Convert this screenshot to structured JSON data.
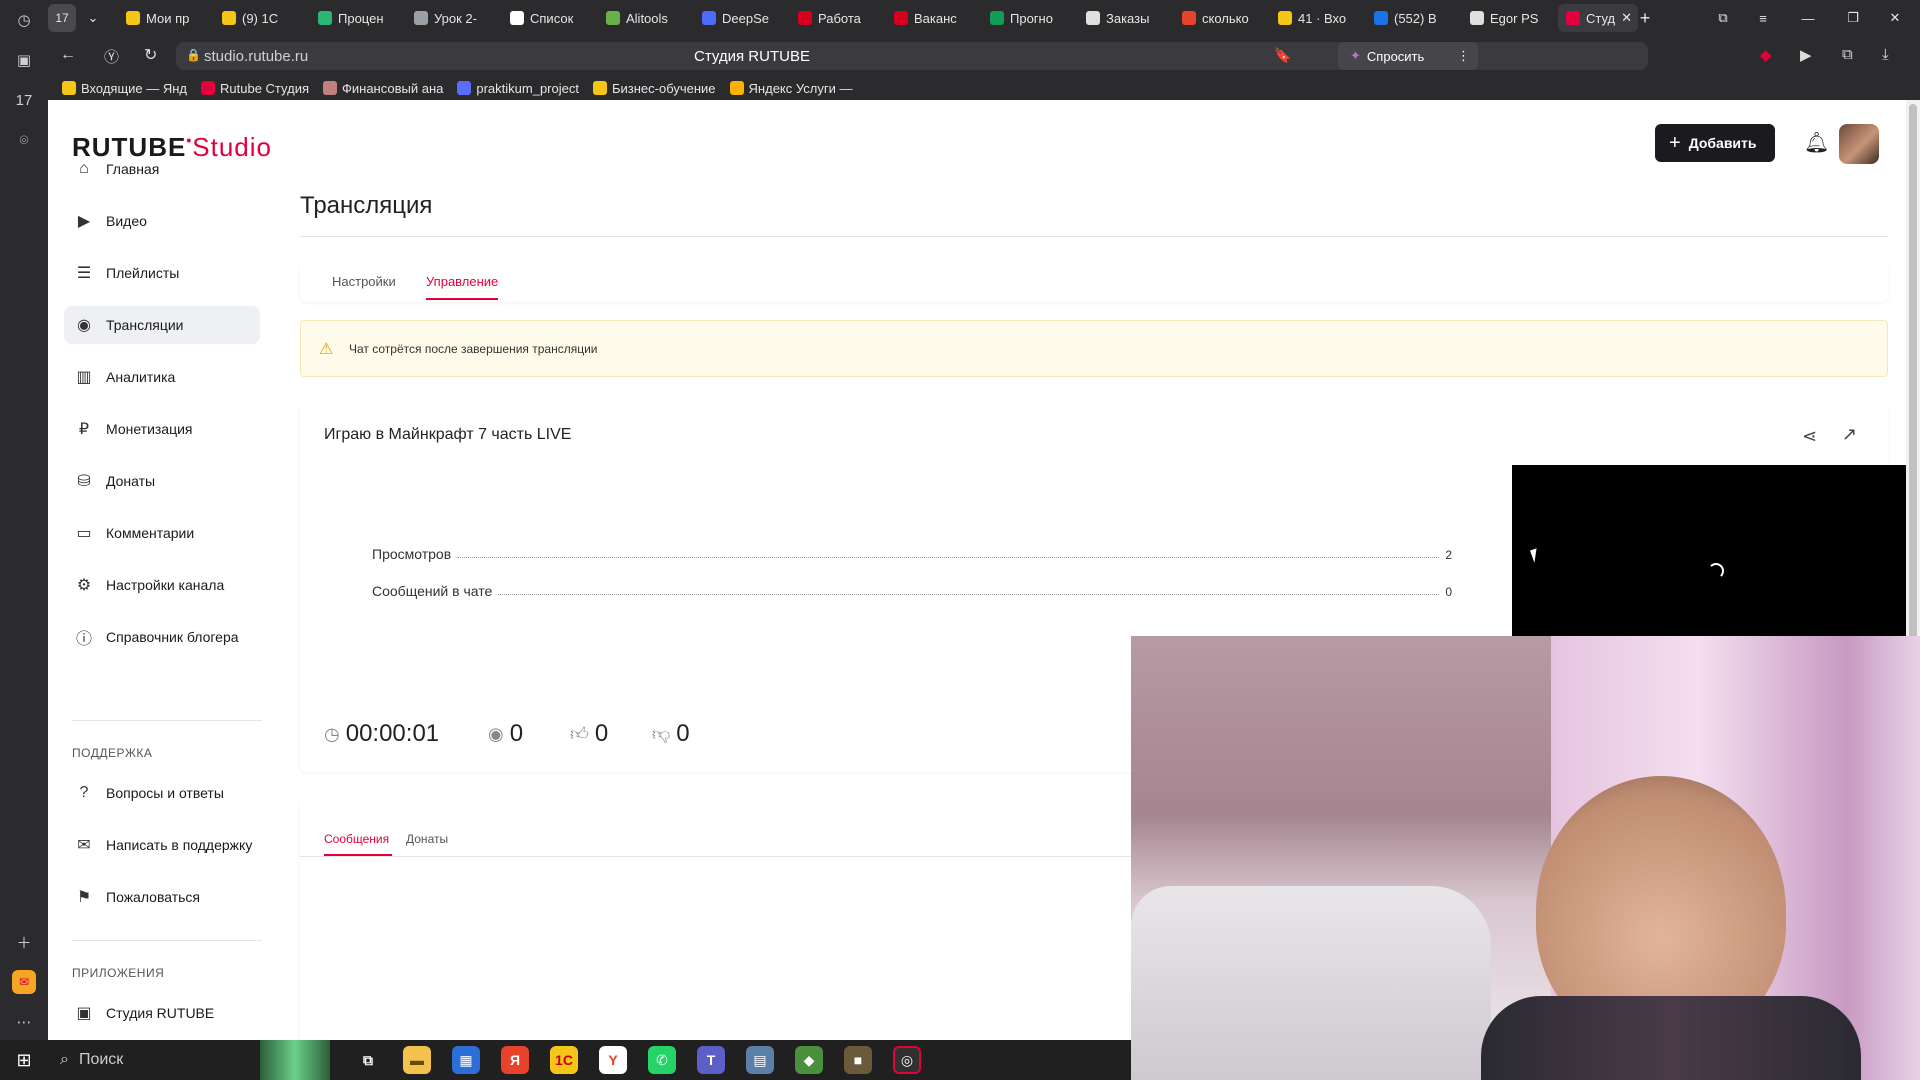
{
  "browser": {
    "tabs": [
      {
        "label": "Мои пр",
        "color": "#f5c518"
      },
      {
        "label": "(9) 1С",
        "color": "#f5c518"
      },
      {
        "label": "Процен",
        "color": "#2bb673"
      },
      {
        "label": "Урок 2-",
        "color": "#9aa0a6"
      },
      {
        "label": "Список",
        "color": "#ffffff"
      },
      {
        "label": "Alitools",
        "color": "#68b04a"
      },
      {
        "label": "DeepSe",
        "color": "#4d6bfe"
      },
      {
        "label": "Работа",
        "color": "#d6001c"
      },
      {
        "label": "Ваканс",
        "color": "#d6001c"
      },
      {
        "label": "Прогно",
        "color": "#0f9d58"
      },
      {
        "label": "Заказы",
        "color": "#e0e0e0"
      },
      {
        "label": "сколько",
        "color": "#e8412c"
      },
      {
        "label": "41 · Вхо",
        "color": "#f5c518"
      },
      {
        "label": "(552) В",
        "color": "#1a73e8"
      },
      {
        "label": "Egor PS",
        "color": "#e0e0e0"
      },
      {
        "label": "Студ",
        "color": "#e4003c",
        "active": true
      }
    ],
    "tab_counter": "17",
    "url": "studio.rutube.ru",
    "page_title": "Студия RUTUBE",
    "ask_label": "Спросить",
    "bookmarks": [
      {
        "label": "Входящие — Янд",
        "color": "#f5c518"
      },
      {
        "label": "Rutube Студия",
        "color": "#e4003c"
      },
      {
        "label": "Финансовый ана",
        "color": "#c08080"
      },
      {
        "label": "praktikum_project",
        "color": "#5b6cff"
      },
      {
        "label": "Бизнес-обучение",
        "color": "#f5c518"
      },
      {
        "label": "Яндекс Услуги —",
        "color": "#ffb000"
      }
    ]
  },
  "app": {
    "logo_main": "RUTUBE",
    "logo_sub": "Studio",
    "accent": "#e4003c",
    "add_button": "Добавить",
    "nav": [
      {
        "label": "Главная",
        "icon": "home-icon"
      },
      {
        "label": "Видео",
        "icon": "video-icon"
      },
      {
        "label": "Плейлисты",
        "icon": "playlist-icon"
      },
      {
        "label": "Трансляции",
        "icon": "broadcast-icon",
        "active": true
      },
      {
        "label": "Аналитика",
        "icon": "analytics-icon"
      },
      {
        "label": "Монетизация",
        "icon": "ruble-icon"
      },
      {
        "label": "Донаты",
        "icon": "donate-icon"
      },
      {
        "label": "Комментарии",
        "icon": "comments-icon"
      },
      {
        "label": "Настройки канала",
        "icon": "gear-icon"
      },
      {
        "label": "Справочник блогера",
        "icon": "info-icon"
      }
    ],
    "support_title": "ПОДДЕРЖКА",
    "support": [
      {
        "label": "Вопросы и ответы",
        "icon": "help-icon"
      },
      {
        "label": "Написать в поддержку",
        "icon": "mail-icon"
      },
      {
        "label": "Пожаловаться",
        "icon": "flag-icon"
      }
    ],
    "apps_title": "ПРИЛОЖЕНИЯ",
    "apps": [
      {
        "label": "Студия RUTUBE",
        "icon": "studio-icon"
      }
    ]
  },
  "main": {
    "title": "Трансляция",
    "tabs": [
      "Настройки",
      "Управление"
    ],
    "warning": "Чат сотрётся после завершения трансляции",
    "stream_title": "Играю в Майнкрафт 7 часть LIVE",
    "stats": [
      {
        "label": "Просмотров",
        "value": "2"
      },
      {
        "label": "Сообщений в чате",
        "value": "0"
      }
    ],
    "metrics": {
      "duration": "00:00:01",
      "viewers": "0",
      "likes": "0",
      "dislikes": "0"
    },
    "chat_tabs": [
      "Сообщения",
      "Донаты"
    ]
  },
  "taskbar": {
    "search_label": "Поиск"
  }
}
